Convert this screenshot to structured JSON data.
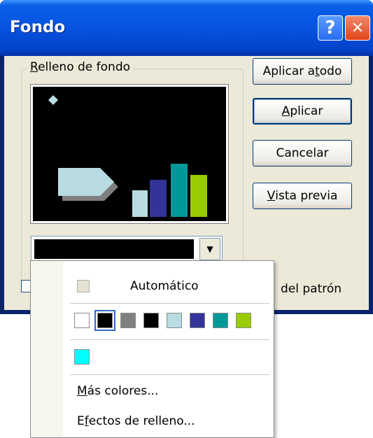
{
  "dialog": {
    "title": "Fondo",
    "help_glyph": "?",
    "close_glyph": "✕"
  },
  "group": {
    "label_first": "R",
    "label_rest": "elleno de fondo"
  },
  "buttons": {
    "apply_all_pre": "Aplicar a ",
    "apply_all_ul": "t",
    "apply_all_post": "odo",
    "apply_ul": "A",
    "apply_rest": "plicar",
    "cancel": "Cancelar",
    "preview_ul": "V",
    "preview_rest": "ista previa"
  },
  "omit_text": "del patrón",
  "combo": {
    "selected_color": "#000000",
    "arrow_glyph": "▼"
  },
  "menu": {
    "automatic": "Automático",
    "palette": [
      {
        "color": "#ffffff",
        "name": "white"
      },
      {
        "color": "#000000",
        "name": "black",
        "selected": true
      },
      {
        "color": "#808080",
        "name": "gray"
      },
      {
        "color": "#000000",
        "name": "black-2"
      },
      {
        "color": "#b8dce2",
        "name": "light-blue"
      },
      {
        "color": "#333399",
        "name": "indigo"
      },
      {
        "color": "#009999",
        "name": "teal"
      },
      {
        "color": "#99cc00",
        "name": "lime"
      }
    ],
    "extra_color": "#00ffff",
    "more_colors_ul": "M",
    "more_colors_rest": "ás colores...",
    "fill_effects_pre": "E",
    "fill_effects_ul": "f",
    "fill_effects_post": "ectos de relleno..."
  },
  "preview": {
    "background": "#000000",
    "bar_colors": [
      "#b8dce2",
      "#333399",
      "#009999",
      "#99cc00"
    ],
    "arrow_color": "#b8dce2",
    "arrow_shadow": "#808080",
    "diamond_color": "#b8dce2"
  }
}
